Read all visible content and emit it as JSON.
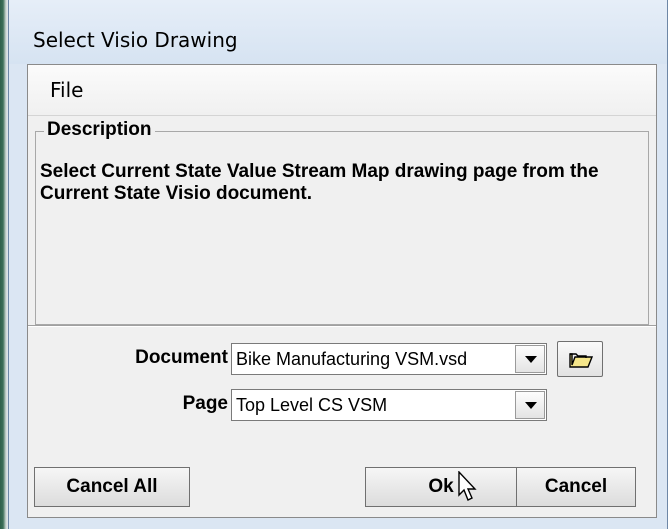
{
  "window": {
    "title": "Select Visio Drawing"
  },
  "menu": {
    "file": "File"
  },
  "description": {
    "legend": "Description",
    "text": "Select Current State Value Stream Map drawing page from the Current State Visio document."
  },
  "form": {
    "document_label": "Document",
    "document_value": "Bike Manufacturing VSM.vsd",
    "page_label": "Page",
    "page_value": "Top Level CS VSM"
  },
  "buttons": {
    "cancel_all": "Cancel All",
    "ok": "Ok",
    "cancel": "Cancel"
  },
  "icons": {
    "browse": "folder-open-icon",
    "pointer": "mouse-pointer-icon"
  }
}
